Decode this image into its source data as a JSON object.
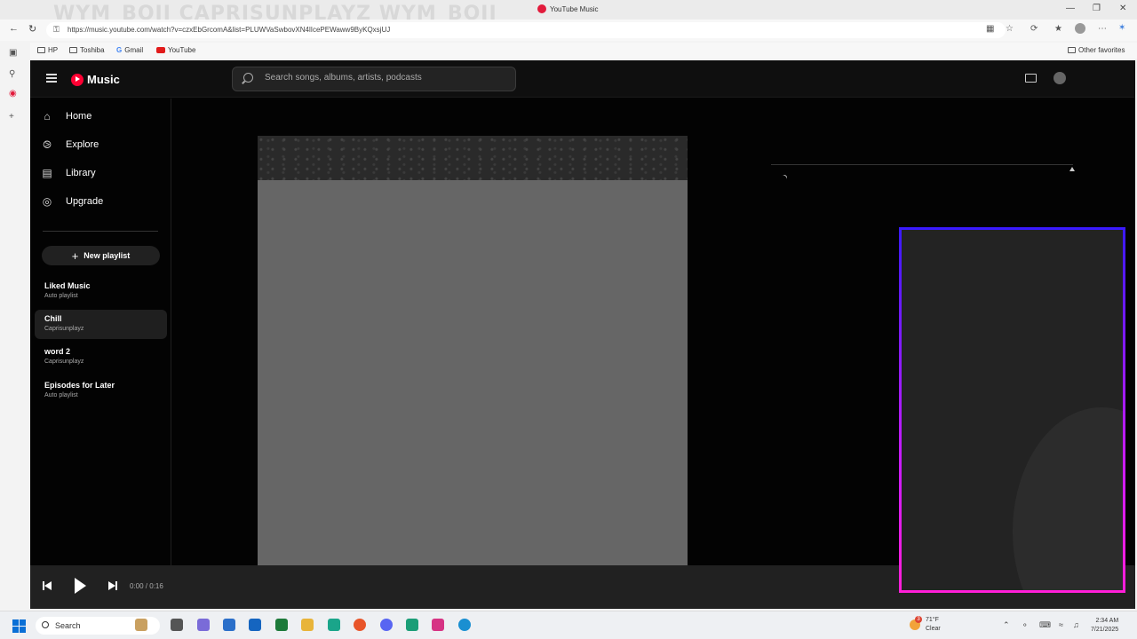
{
  "browser": {
    "watermark": "WYM_BOII  CAPRISUNPLAYZ  WYM_BOII",
    "tab_title": "YouTube Music",
    "url": "https://music.youtube.com/watch?v=czxEbGrcomA&list=PLUWVaSwbovXN4lIcePEWaww9ByKQxsjUJ",
    "bookmarks": [
      "HP",
      "Toshiba",
      "Gmail",
      "YouTube"
    ],
    "other_favorites": "Other favorites"
  },
  "app": {
    "logo_text": "Music",
    "search_placeholder": "Search songs, albums, artists, podcasts",
    "nav": [
      {
        "label": "Home",
        "icon": "home-icon"
      },
      {
        "label": "Explore",
        "icon": "compass-icon"
      },
      {
        "label": "Library",
        "icon": "library-icon"
      },
      {
        "label": "Upgrade",
        "icon": "upgrade-icon"
      }
    ],
    "new_playlist": "New playlist",
    "playlists": [
      {
        "title": "Liked Music",
        "subtitle": "Auto playlist"
      },
      {
        "title": "Chill",
        "subtitle": "Caprisunplayz"
      },
      {
        "title": "word 2",
        "subtitle": "Caprisunplayz"
      },
      {
        "title": "Episodes for Later",
        "subtitle": "Auto playlist"
      }
    ],
    "player": {
      "time": "0:00 / 0:16"
    }
  },
  "taskbar": {
    "search": "Search",
    "weather_temp": "71°F",
    "weather_desc": "Clear",
    "weather_badge": "3",
    "time": "2:34 AM",
    "date": "7/21/2025"
  },
  "colors": {
    "accent": "#ff0033",
    "cam_border_top": "#3a1aff",
    "cam_border_bottom": "#ff1ed8"
  }
}
